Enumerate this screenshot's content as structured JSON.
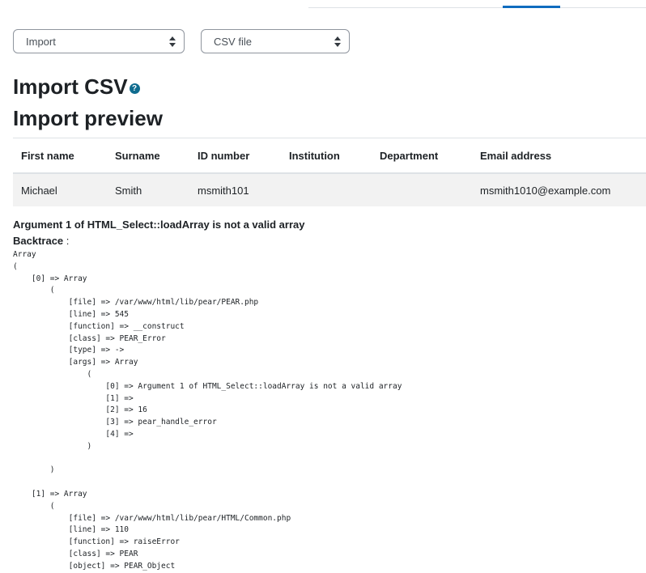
{
  "selects": {
    "first": "Import",
    "second": "CSV file"
  },
  "headings": {
    "title": "Import CSV",
    "help_icon": "?",
    "subtitle": "Import preview"
  },
  "table": {
    "columns": [
      "First name",
      "Surname",
      "ID number",
      "Institution",
      "Department",
      "Email address"
    ],
    "rows": [
      [
        "Michael",
        "Smith",
        "msmith101",
        "",
        "",
        "msmith1010@example.com"
      ]
    ]
  },
  "error": {
    "message": "Argument 1 of HTML_Select::loadArray is not a valid array",
    "backtrace_label": "Backtrace",
    "backtrace_sep": " :",
    "trace": "Array\n(\n    [0] => Array\n        (\n            [file] => /var/www/html/lib/pear/PEAR.php\n            [line] => 545\n            [function] => __construct\n            [class] => PEAR_Error\n            [type] => ->\n            [args] => Array\n                (\n                    [0] => Argument 1 of HTML_Select::loadArray is not a valid array\n                    [1] => \n                    [2] => 16\n                    [3] => pear_handle_error\n                    [4] => \n                )\n\n        )\n\n    [1] => Array\n        (\n            [file] => /var/www/html/lib/pear/HTML/Common.php\n            [line] => 110\n            [function] => raiseError\n            [class] => PEAR\n            [object] => PEAR_Object"
  }
}
